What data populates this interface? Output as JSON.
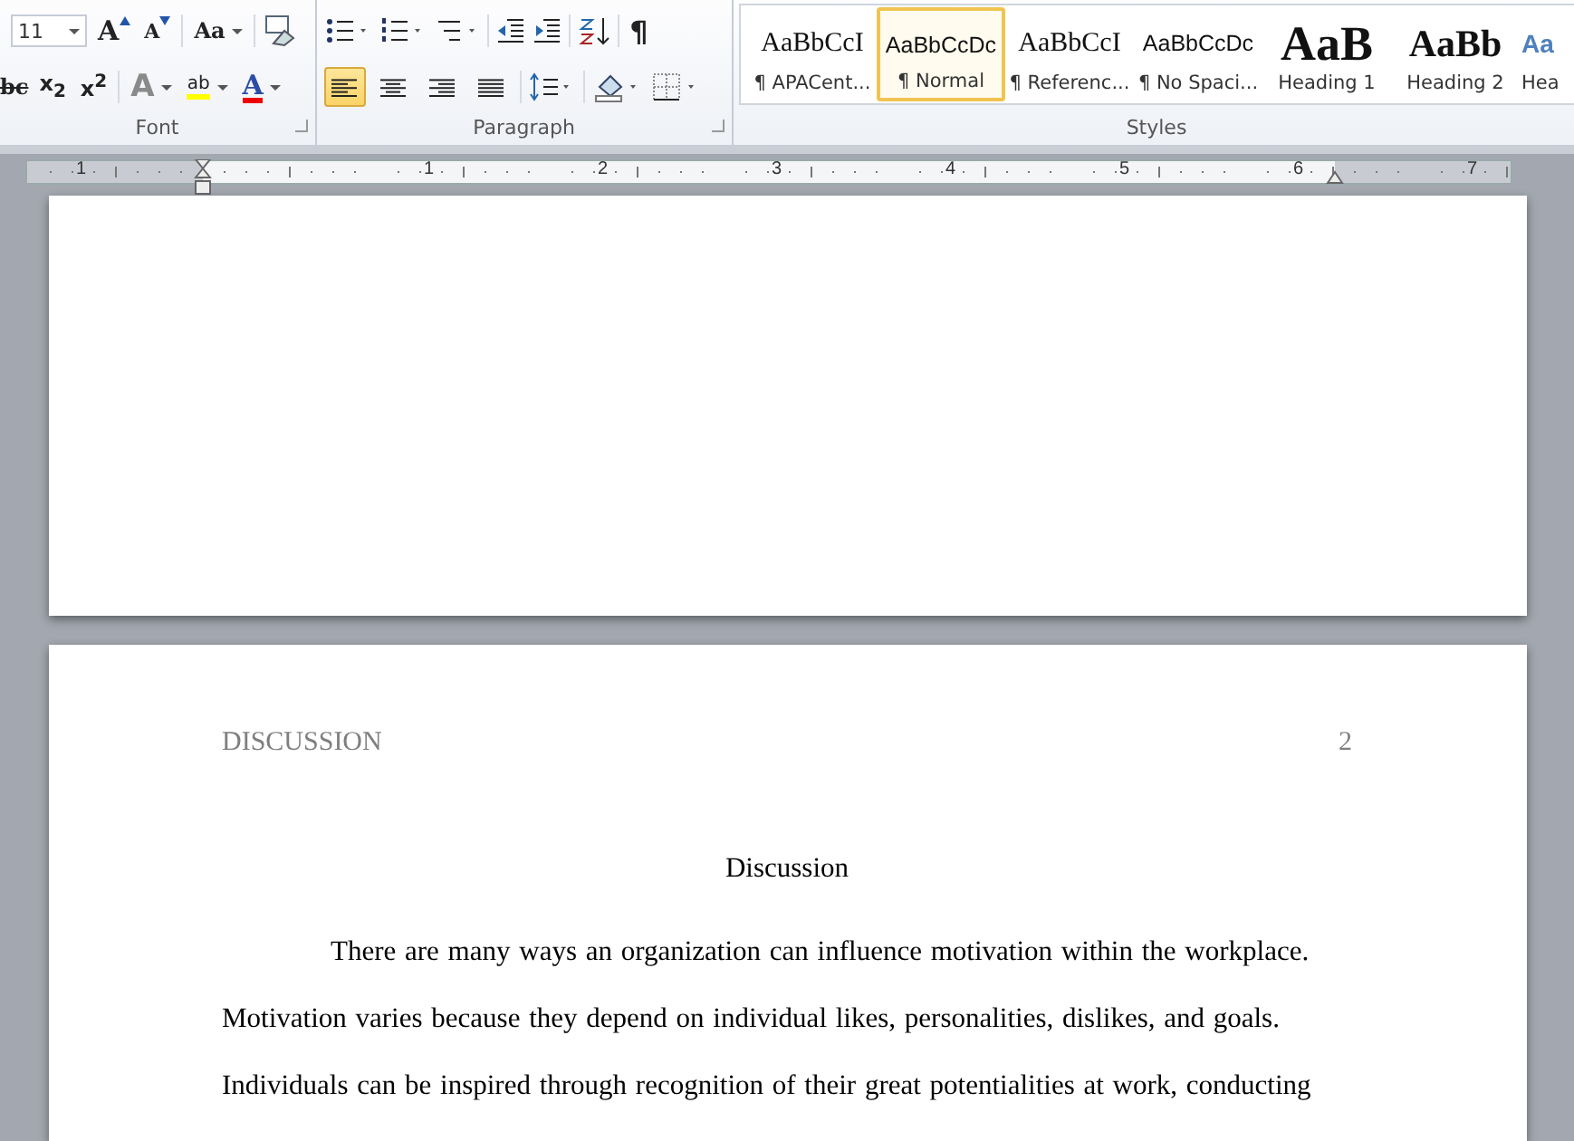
{
  "font_group": {
    "label": "Font",
    "font_size": "11",
    "grow_font": "A",
    "shrink_font": "A",
    "change_case": "Aa",
    "strikethrough": "bc",
    "subscript": "x$_{2}$",
    "superscript": "x$^{2}$",
    "text_effects": "A",
    "highlight": "ab",
    "font_color": "A"
  },
  "paragraph_group": {
    "label": "Paragraph",
    "pilcrow": "¶",
    "alignments": [
      {
        "selected": true
      },
      {
        "selected": false
      },
      {
        "selected": false
      },
      {
        "selected": false
      }
    ]
  },
  "styles_group": {
    "label": "Styles",
    "styles": [
      {
        "kind": "serif",
        "preview": "AaBbCcI",
        "name": "¶ APACent...",
        "selected": false
      },
      {
        "kind": "sans",
        "preview": "AaBbCcDc",
        "name": "¶ Normal",
        "selected": true
      },
      {
        "kind": "serif",
        "preview": "AaBbCcI",
        "name": "¶ Referenc...",
        "selected": false
      },
      {
        "kind": "sans",
        "preview": "AaBbCcDc",
        "name": "¶ No Spaci...",
        "selected": false
      },
      {
        "kind": "h1",
        "preview": "AaB",
        "name": "Heading 1",
        "selected": false
      },
      {
        "kind": "h2",
        "preview": "AaBb",
        "name": "Heading 2",
        "selected": false
      },
      {
        "kind": "h3",
        "preview": "Aa",
        "name": "Hea",
        "selected": false
      }
    ]
  },
  "ruler": {
    "numbers": [
      "1",
      "1",
      "2",
      "3",
      "4",
      "5",
      "6",
      "7"
    ]
  },
  "document": {
    "header_title": "DISCUSSION",
    "page_number": "2",
    "title": "Discussion",
    "lines": [
      "There are many ways an organization can influence motivation within the workplace.",
      "Motivation varies because they depend on individual likes, personalities,  dislikes, and goals.",
      "Individuals can be inspired through recognition of their great potentialities at work, conducting"
    ]
  }
}
